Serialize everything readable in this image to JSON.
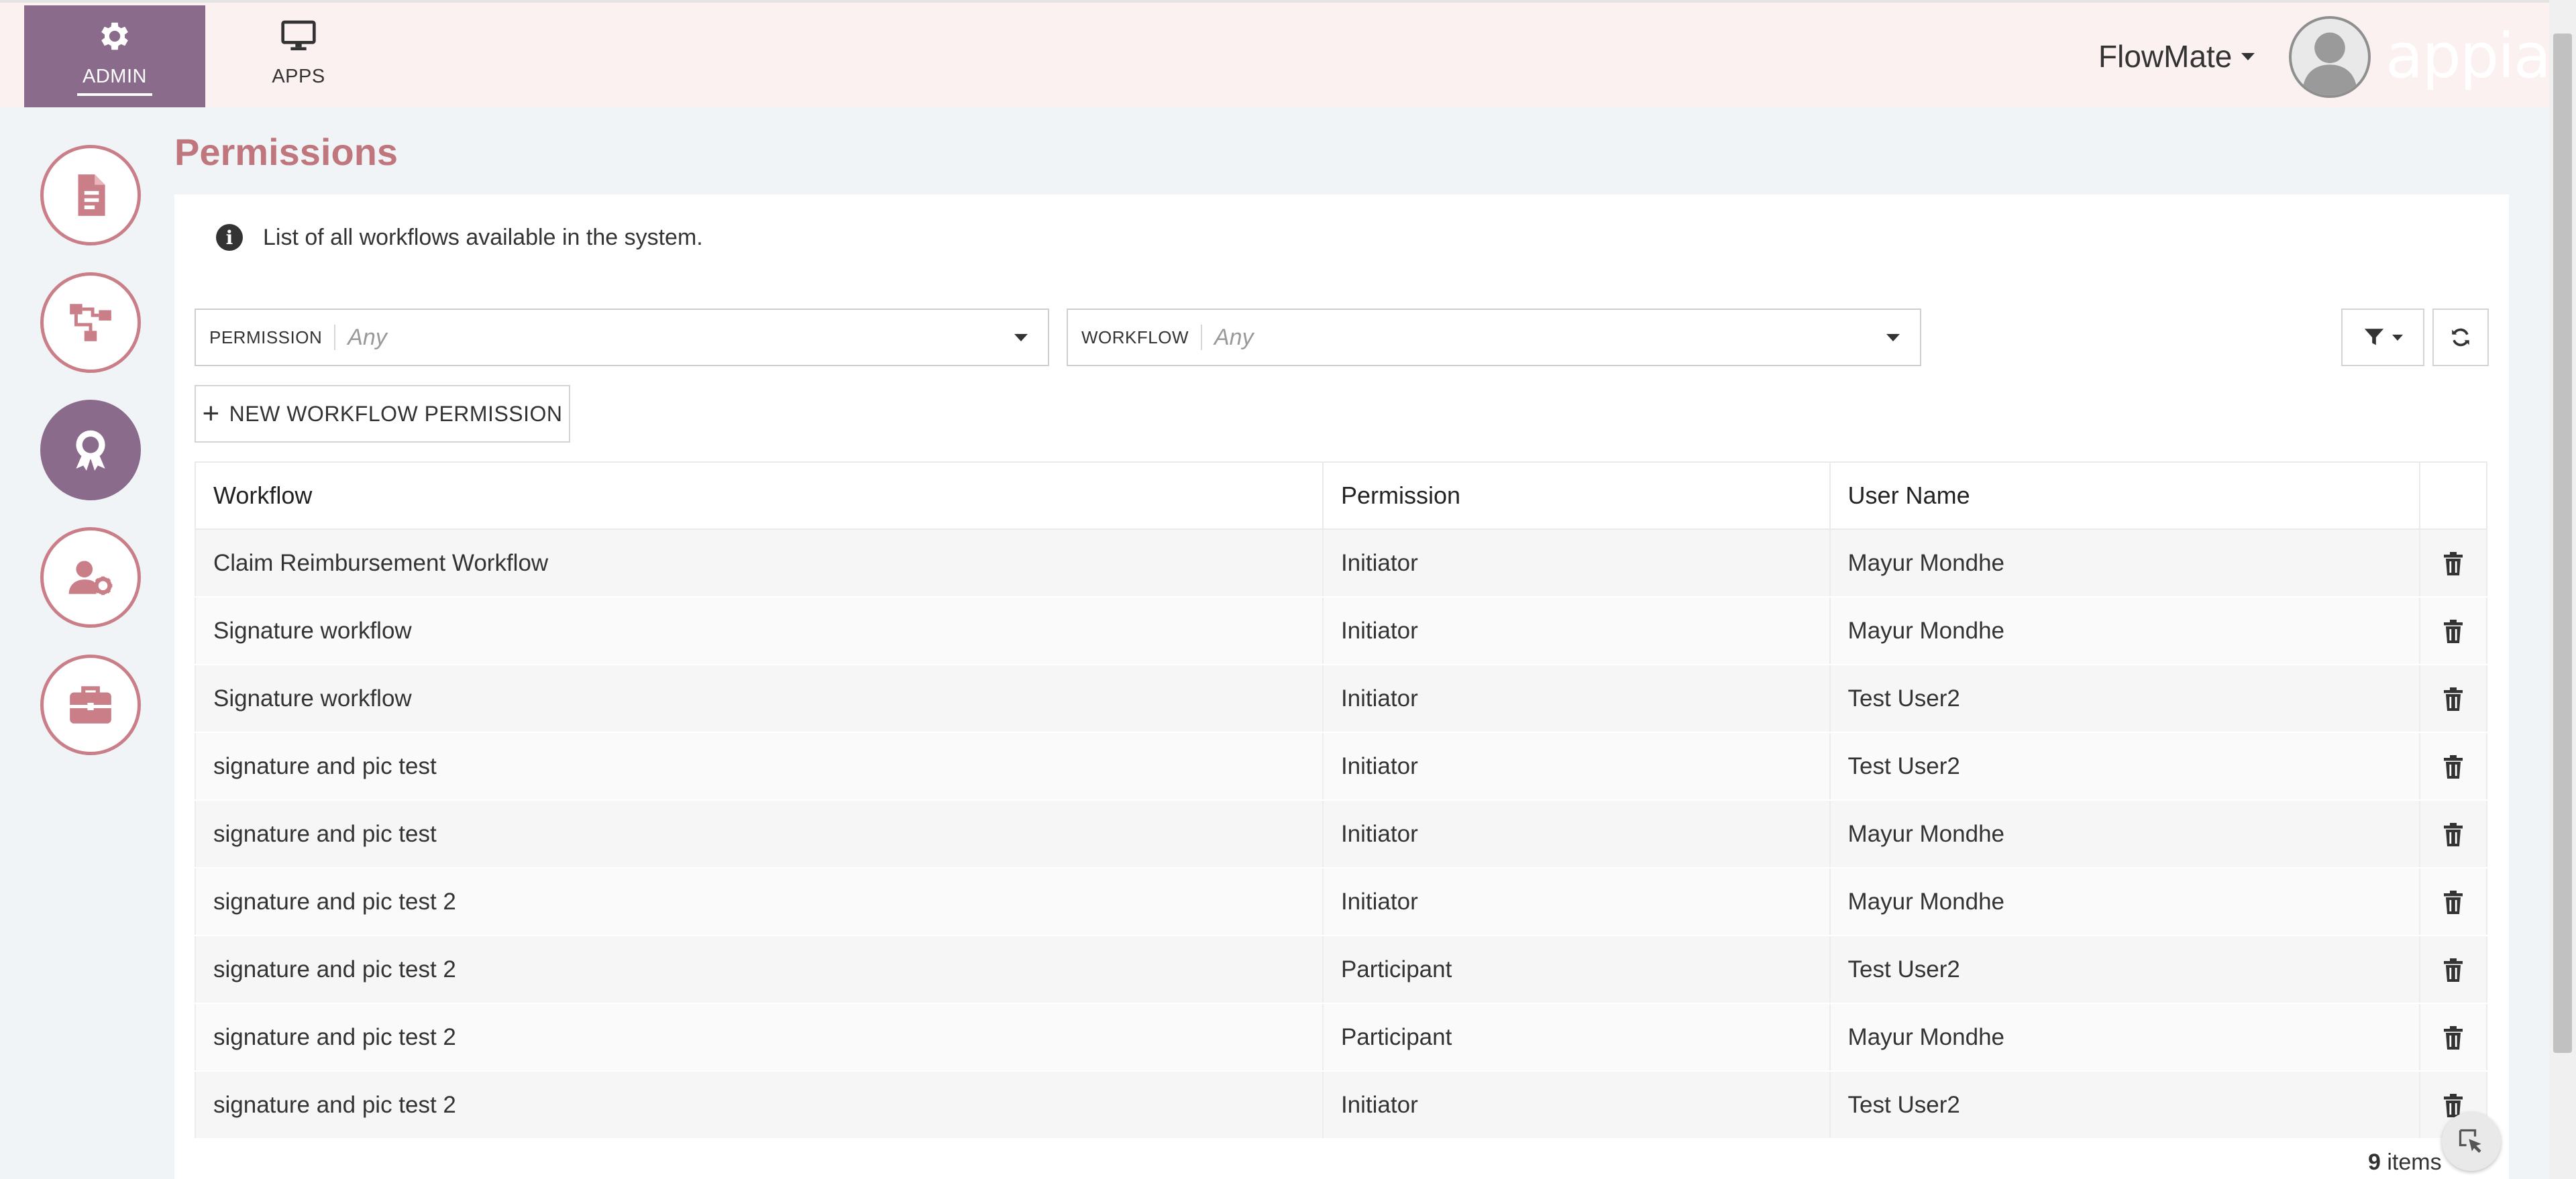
{
  "nav": {
    "admin_label": "ADMIN",
    "apps_label": "APPS"
  },
  "user": {
    "name": "FlowMate"
  },
  "brand": "appian",
  "sidebar": {
    "items": [
      {
        "icon": "document-icon"
      },
      {
        "icon": "workflow-icon"
      },
      {
        "icon": "award-icon",
        "active": true
      },
      {
        "icon": "user-settings-icon"
      },
      {
        "icon": "briefcase-icon"
      }
    ]
  },
  "page": {
    "title": "Permissions",
    "info_text": "List of all workflows available in the system."
  },
  "filters": {
    "permission": {
      "label": "PERMISSION",
      "placeholder": "Any"
    },
    "workflow": {
      "label": "WORKFLOW",
      "placeholder": "Any"
    }
  },
  "actions": {
    "new_label": "NEW WORKFLOW PERMISSION"
  },
  "table": {
    "columns": [
      "Workflow",
      "Permission",
      "User Name"
    ],
    "rows": [
      {
        "workflow": "Claim Reimbursement Workflow",
        "permission": "Initiator",
        "user": "Mayur Mondhe"
      },
      {
        "workflow": "Signature workflow",
        "permission": "Initiator",
        "user": "Mayur Mondhe"
      },
      {
        "workflow": "Signature workflow",
        "permission": "Initiator",
        "user": "Test User2"
      },
      {
        "workflow": "signature and pic test",
        "permission": "Initiator",
        "user": "Test User2"
      },
      {
        "workflow": "signature and pic test",
        "permission": "Initiator",
        "user": "Mayur Mondhe"
      },
      {
        "workflow": "signature and pic test 2",
        "permission": "Initiator",
        "user": "Mayur Mondhe"
      },
      {
        "workflow": "signature and pic test 2",
        "permission": "Participant",
        "user": "Test User2"
      },
      {
        "workflow": "signature and pic test 2",
        "permission": "Participant",
        "user": "Mayur Mondhe"
      },
      {
        "workflow": "signature and pic test 2",
        "permission": "Initiator",
        "user": "Test User2"
      }
    ],
    "count_number": "9",
    "count_suffix": "items"
  },
  "colors": {
    "accent": "#8b6b8b",
    "title": "#c0767d",
    "topbar_bg": "#fcf1f1"
  }
}
